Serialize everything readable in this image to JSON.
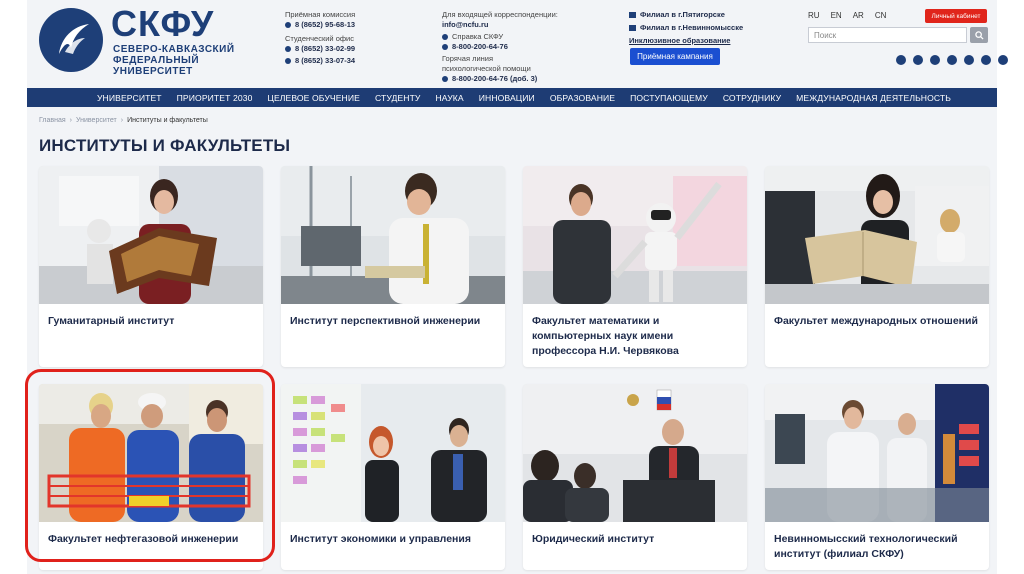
{
  "header": {
    "logo_text": "СКФУ",
    "logo_sub": [
      "СЕВЕРО-КАВКАЗСКИЙ",
      "ФЕДЕРАЛЬНЫЙ",
      "УНИВЕРСИТЕТ"
    ],
    "admissions_label": "Приёмная комиссия",
    "admissions_phone": "8 (8652) 95-68-13",
    "student_office_label": "Студенческий офис",
    "student_office_phone1": "8 (8652) 33-02-99",
    "student_office_phone2": "8 (8652) 33-07-34",
    "correspondence_label": "Для входящей корреспонденции:",
    "correspondence_email": "info@ncfu.ru",
    "reference_label": "Справка СКФУ",
    "reference_phone": "8-800-200-64-76",
    "hotline_label1": "Горячая линия",
    "hotline_label2": "психологической помощи",
    "hotline_phone": "8-800-200-64-76 (доб. 3)",
    "branch1": "Филиал в г.Пятигорске",
    "branch2": "Филиал в г.Невинномысске",
    "inclusive_link": "Инклюзивное образование",
    "campaign_button": "Приёмная кампания",
    "languages": [
      "RU",
      "EN",
      "AR",
      "CN"
    ],
    "cabinet_button": "Личный кабинет",
    "search_placeholder": "Поиск",
    "socials": [
      "telegram-icon",
      "vk-icon",
      "youtube-icon",
      "ok-icon",
      "rutube-icon",
      "dzen-icon",
      "more-icon"
    ]
  },
  "nav": [
    "УНИВЕРСИТЕТ",
    "ПРИОРИТЕТ 2030",
    "ЦЕЛЕВОЕ ОБУЧЕНИЕ",
    "СТУДЕНТУ",
    "НАУКА",
    "ИННОВАЦИИ",
    "ОБРАЗОВАНИЕ",
    "ПОСТУПАЮЩЕМУ",
    "СОТРУДНИКУ",
    "МЕЖДУНАРОДНАЯ ДЕЯТЕЛЬНОСТЬ"
  ],
  "breadcrumb": [
    "Главная",
    "Университет",
    "Институты и факультеты"
  ],
  "page_title": "ИНСТИТУТЫ И ФАКУЛЬТЕТЫ",
  "institutes": [
    "Гуманитарный институт",
    "Институт перспективной инженерии",
    "Факультет математики и компьютерных наук имени профессора Н.И. Червякова",
    "Факультет международных отношений",
    "Факультет нефтегазовой инженерии",
    "Институт экономики и управления",
    "Юридический институт",
    "Невинномысский технологический институт (филиал СКФУ)"
  ],
  "colors": {
    "brand_blue": "#1e3f78",
    "nav_bg": "#1e3c74",
    "campaign_button": "#1b4fd1",
    "cabinet_button": "#e0251b",
    "highlight": "#e0211b"
  }
}
